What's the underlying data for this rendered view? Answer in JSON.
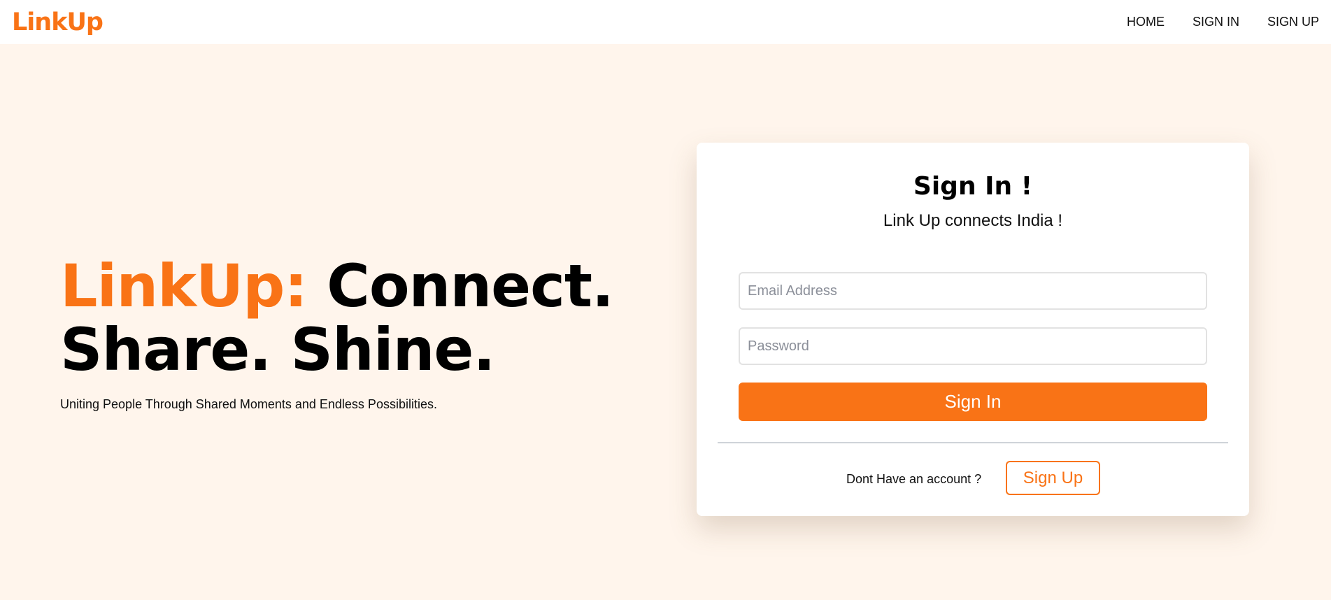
{
  "navbar": {
    "brand": "LinkUp",
    "links": [
      {
        "label": "HOME"
      },
      {
        "label": "SIGN IN"
      },
      {
        "label": "SIGN UP"
      }
    ]
  },
  "hero": {
    "title_accent": "LinkUp:",
    "title_line1_rest": " Connect.",
    "title_line2": "Share. Shine.",
    "subtitle": "Uniting People Through Shared Moments and Endless Possibilities."
  },
  "signin_card": {
    "title": "Sign In !",
    "subtitle": "Link Up connects India !",
    "email_placeholder": "Email Address",
    "email_value": "",
    "password_placeholder": "Password",
    "password_value": "",
    "submit_label": "Sign In",
    "signup_prompt": "Dont Have an account ?",
    "signup_label": "Sign Up"
  },
  "colors": {
    "accent": "#f97316",
    "background": "#fff5ec",
    "card": "#ffffff"
  }
}
